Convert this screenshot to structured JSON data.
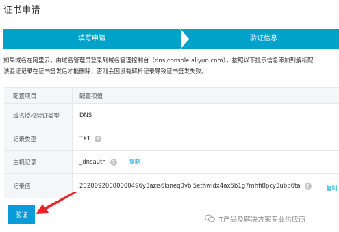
{
  "page": {
    "title": "证书申请"
  },
  "steps": [
    {
      "label": "填写申请",
      "active": true
    },
    {
      "label": "验证信息",
      "active": true
    }
  ],
  "info": {
    "line1": "如果域名在阿里云，由域名管理员登录到域名管理控制台（dns.console.aliyun.com），按照以下提示信息添加到解析配",
    "line2": "该验证记录在证书签发后才能删除，否则会因没有解析记录导致证书签发失败。"
  },
  "table": {
    "header": {
      "key": "配置项目",
      "value": "配置项值"
    },
    "rows": [
      {
        "key": "域名授权验证类型",
        "value": "DNS",
        "help": false,
        "copy": ""
      },
      {
        "key": "记录类型",
        "value": "TXT",
        "help": true,
        "copy": ""
      },
      {
        "key": "主机记录",
        "value": "_dnsauth",
        "help": true,
        "copy": "复制"
      },
      {
        "key": "记录值",
        "value": "20200920000000496y3azis6kineq0vbi5ethwidx4ax5b1g7mhfi8pcy3ubp6ta",
        "help": true,
        "copy": "复制"
      }
    ]
  },
  "actions": {
    "verify_label": "验证"
  },
  "watermark": {
    "text": "IT产品及解决方案专业供应商",
    "icon": "wechat-icon"
  },
  "colors": {
    "accent": "#00a2ca",
    "button": "#0a9cd8",
    "arrow": "#e8262a"
  }
}
